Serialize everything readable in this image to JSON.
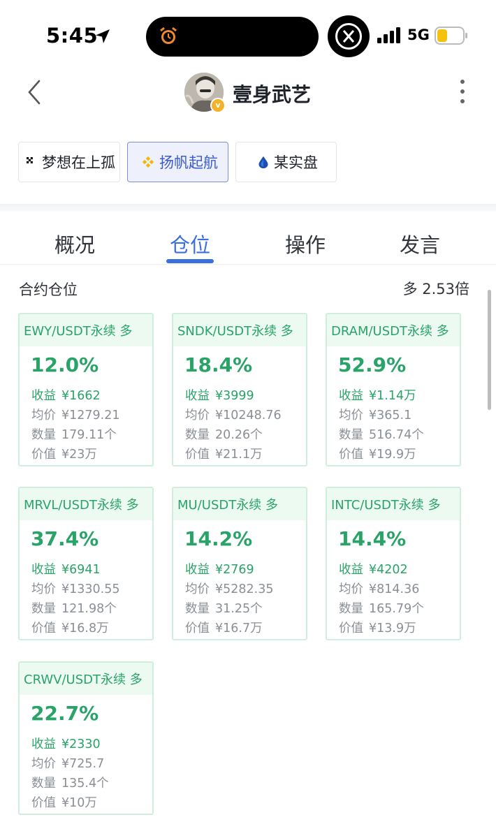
{
  "status_bar": {
    "time": "5:45",
    "network": "5G",
    "icons": [
      "location-arrow-icon",
      "alarm-clock-icon",
      "x-app-icon",
      "cell-signal-icon",
      "battery-icon"
    ]
  },
  "header": {
    "title": "壹身武艺",
    "back_icon": "chevron-left-icon",
    "more_icon": "vertical-ellipsis-icon",
    "verified_badge": "v"
  },
  "accounts": [
    {
      "label": "梦想在上孤",
      "icon": "exchange-x-icon",
      "active": false
    },
    {
      "label": "扬帆起航",
      "icon": "binance-diamond-icon",
      "active": true
    },
    {
      "label": "某实盘",
      "icon": "droplet-icon",
      "active": false
    }
  ],
  "tabs": [
    {
      "label": "概况",
      "active": false
    },
    {
      "label": "仓位",
      "active": true
    },
    {
      "label": "操作",
      "active": false
    },
    {
      "label": "发言",
      "active": false
    }
  ],
  "section": {
    "title": "合约仓位",
    "leverage": "多 2.53倍"
  },
  "labels": {
    "profit": "收益",
    "avg_price": "均价",
    "quantity": "数量",
    "value": "价值"
  },
  "positions": [
    {
      "symbol": "EWY/USDT永续 多",
      "pct": "12.0%",
      "profit": "¥1662",
      "avg_price": "¥1279.21",
      "quantity": "179.11个",
      "value": "¥23万"
    },
    {
      "symbol": "SNDK/USDT永续 多",
      "pct": "18.4%",
      "profit": "¥3999",
      "avg_price": "¥10248.76",
      "quantity": "20.26个",
      "value": "¥21.1万"
    },
    {
      "symbol": "DRAM/USDT永续 多",
      "pct": "52.9%",
      "profit": "¥1.14万",
      "avg_price": "¥365.1",
      "quantity": "516.74个",
      "value": "¥19.9万"
    },
    {
      "symbol": "MRVL/USDT永续 多",
      "pct": "37.4%",
      "profit": "¥6941",
      "avg_price": "¥1330.55",
      "quantity": "121.98个",
      "value": "¥16.8万"
    },
    {
      "symbol": "MU/USDT永续 多",
      "pct": "14.2%",
      "profit": "¥2769",
      "avg_price": "¥5282.35",
      "quantity": "31.25个",
      "value": "¥16.7万"
    },
    {
      "symbol": "INTC/USDT永续 多",
      "pct": "14.4%",
      "profit": "¥4202",
      "avg_price": "¥814.36",
      "quantity": "165.79个",
      "value": "¥13.9万"
    },
    {
      "symbol": "CRWV/USDT永续 多",
      "pct": "22.7%",
      "profit": "¥2330",
      "avg_price": "¥725.7",
      "quantity": "135.4个",
      "value": "¥10万"
    }
  ],
  "colors": {
    "accent_blue": "#3b6fe0",
    "profit_green": "#2aa369",
    "card_header_bg": "#ecfaf2",
    "card_border": "#cfeedd"
  }
}
